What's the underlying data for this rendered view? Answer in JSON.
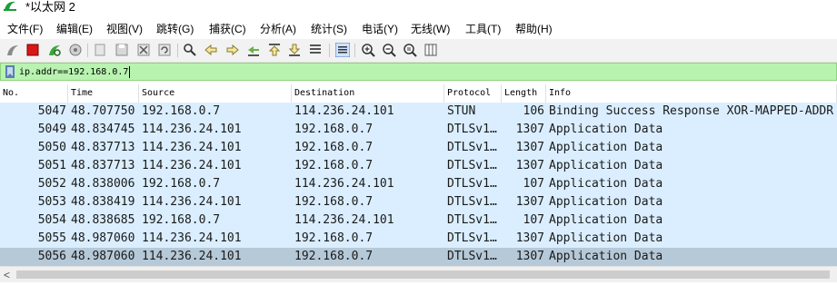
{
  "window": {
    "title": "*以太网 2"
  },
  "menu": [
    "文件(F)",
    "编辑(E)",
    "视图(V)",
    "跳转(G)",
    "捕获(C)",
    "分析(A)",
    "统计(S)",
    "电话(Y)",
    "无线(W)",
    "工具(T)",
    "帮助(H)"
  ],
  "toolbar": {
    "icons": [
      "shark-fin-start-icon",
      "stop-capture-icon",
      "restart-capture-icon",
      "capture-options-icon",
      "open-file-icon",
      "save-file-icon",
      "close-file-icon",
      "reload-icon",
      "find-packet-icon",
      "go-back-icon",
      "go-forward-icon",
      "go-to-packet-icon",
      "go-first-icon",
      "go-last-icon",
      "auto-scroll-icon",
      "colorize-icon",
      "zoom-in-icon",
      "zoom-out-icon",
      "normal-size-icon",
      "resize-columns-icon"
    ]
  },
  "filter": {
    "value": "ip.addr==192.168.0.7"
  },
  "columns": [
    "No.",
    "Time",
    "Source",
    "Destination",
    "Protocol",
    "Length",
    "Info"
  ],
  "packets": [
    {
      "no": "5047",
      "time": "48.707750",
      "src": "192.168.0.7",
      "dst": "114.236.24.101",
      "proto": "STUN",
      "len": "106",
      "info": "Binding Success Response XOR-MAPPED-ADDR"
    },
    {
      "no": "5049",
      "time": "48.834745",
      "src": "114.236.24.101",
      "dst": "192.168.0.7",
      "proto": "DTLSv1…",
      "len": "1307",
      "info": "Application Data"
    },
    {
      "no": "5050",
      "time": "48.837713",
      "src": "114.236.24.101",
      "dst": "192.168.0.7",
      "proto": "DTLSv1…",
      "len": "1307",
      "info": "Application Data"
    },
    {
      "no": "5051",
      "time": "48.837713",
      "src": "114.236.24.101",
      "dst": "192.168.0.7",
      "proto": "DTLSv1…",
      "len": "1307",
      "info": "Application Data"
    },
    {
      "no": "5052",
      "time": "48.838006",
      "src": "192.168.0.7",
      "dst": "114.236.24.101",
      "proto": "DTLSv1…",
      "len": "107",
      "info": "Application Data"
    },
    {
      "no": "5053",
      "time": "48.838419",
      "src": "114.236.24.101",
      "dst": "192.168.0.7",
      "proto": "DTLSv1…",
      "len": "1307",
      "info": "Application Data"
    },
    {
      "no": "5054",
      "time": "48.838685",
      "src": "192.168.0.7",
      "dst": "114.236.24.101",
      "proto": "DTLSv1…",
      "len": "107",
      "info": "Application Data"
    },
    {
      "no": "5055",
      "time": "48.987060",
      "src": "114.236.24.101",
      "dst": "192.168.0.7",
      "proto": "DTLSv1…",
      "len": "1307",
      "info": "Application Data"
    },
    {
      "no": "5056",
      "time": "48.987060",
      "src": "114.236.24.101",
      "dst": "192.168.0.7",
      "proto": "DTLSv1…",
      "len": "1307",
      "info": "Application Data",
      "selected": true
    }
  ],
  "colors": {
    "row_bg": "#daeeff",
    "row_selected": "#b6c9d8",
    "filter_valid": "#b8f3b0"
  }
}
